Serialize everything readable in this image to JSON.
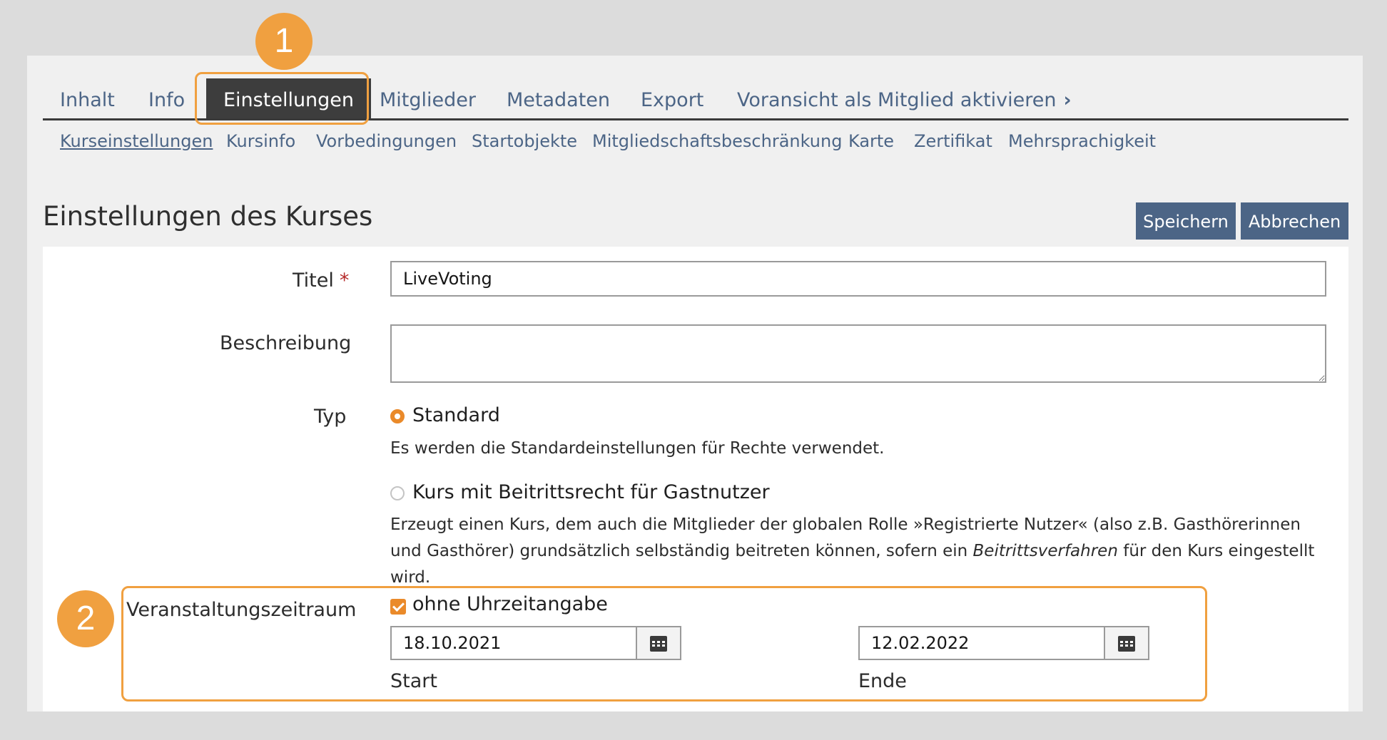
{
  "tabs": [
    {
      "label": "Inhalt"
    },
    {
      "label": "Info"
    },
    {
      "label": "Einstellungen",
      "active": true
    },
    {
      "label": "Mitglieder"
    },
    {
      "label": "Metadaten"
    },
    {
      "label": "Export"
    },
    {
      "label": "Voransicht als Mitglied aktivieren"
    }
  ],
  "subtabs": [
    {
      "label": "Kurseinstellungen",
      "active": true
    },
    {
      "label": "Kursinfo"
    },
    {
      "label": "Vorbedingungen"
    },
    {
      "label": "Startobjekte"
    },
    {
      "label": "Mitgliedschaftsbeschränkung"
    },
    {
      "label": "Karte"
    },
    {
      "label": "Zertifikat"
    },
    {
      "label": "Mehrsprachigkeit"
    }
  ],
  "header": {
    "title": "Einstellungen des Kurses",
    "save_label": "Speichern",
    "cancel_label": "Abbrechen"
  },
  "form": {
    "title_label": "Titel",
    "required_mark": "*",
    "title_value": "LiveVoting",
    "description_label": "Beschreibung",
    "description_value": "",
    "type_label": "Typ",
    "type_options": [
      {
        "label": "Standard",
        "checked": true,
        "help": "Es werden die Standardeinstellungen für Rechte verwendet."
      },
      {
        "label": "Kurs mit Beitrittsrecht für Gastnutzer",
        "checked": false,
        "help_before": "Erzeugt einen Kurs, dem auch die Mitglieder der globalen Rolle »Registrierte Nutzer« (also z.B. Gasthörerinnen und Gasthörer) grundsätzlich selbständig beitreten können, sofern ein ",
        "help_em": "Beitrittsverfahren",
        "help_after": " für den Kurs eingestellt wird."
      }
    ],
    "period_label": "Veranstaltungszeitraum",
    "no_time_label": "ohne Uhrzeitangabe",
    "no_time_checked": true,
    "start_value": "18.10.2021",
    "start_label": "Start",
    "end_value": "12.02.2022",
    "end_label": "Ende"
  },
  "callouts": [
    {
      "number": "1"
    },
    {
      "number": "2"
    }
  ],
  "colors": {
    "accent_orange": "#ea8a2a",
    "link_blue": "#4c6586",
    "active_tab_bg": "#3d3d3d"
  },
  "icons": {
    "tab_more": "chevron-right-icon",
    "date_picker": "calendar-icon"
  }
}
